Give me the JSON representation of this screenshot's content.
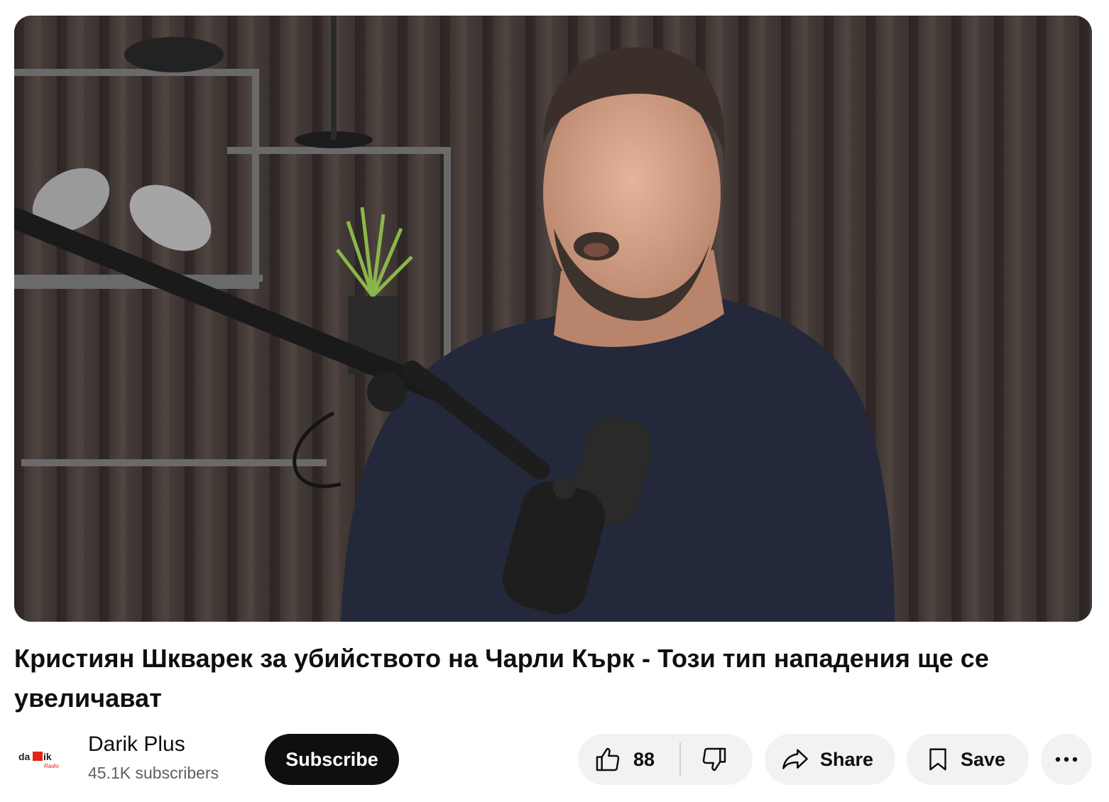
{
  "video": {
    "title": "Кристиян Шкварек за убийството на Чарли Кърк - Този тип нападения ще се увеличават"
  },
  "channel": {
    "name": "Darik Plus",
    "subscribers": "45.1K subscribers",
    "logo_text": "darik Radio"
  },
  "buttons": {
    "subscribe": "Subscribe",
    "like_count": "88",
    "share": "Share",
    "save": "Save"
  },
  "icons": {
    "like": "thumbs-up-icon",
    "dislike": "thumbs-down-icon",
    "share": "share-arrow-icon",
    "save": "bookmark-icon",
    "more": "more-horizontal-icon"
  },
  "colors": {
    "subscribe_bg": "#0f0f0f",
    "pill_bg": "#f2f2f2",
    "secondary_text": "#606060",
    "logo_red": "#e2231a"
  }
}
